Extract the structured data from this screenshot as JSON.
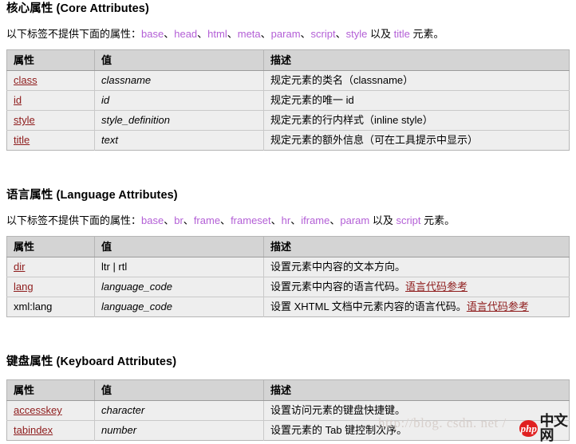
{
  "sections": [
    {
      "heading": "核心属性 (Core Attributes)",
      "intro_prefix": "以下标签不提供下面的属性：",
      "intro_tags": [
        "base",
        "head",
        "html",
        "meta",
        "param",
        "script",
        "style"
      ],
      "intro_mid": " 以及 ",
      "intro_last_tag": "title",
      "intro_suffix": " 元素。",
      "columns": [
        "属性",
        "值",
        "描述"
      ],
      "rows": [
        {
          "attr": "class",
          "attr_is_link": true,
          "value": "classname",
          "value_italic": true,
          "desc": "规定元素的类名（classname）",
          "desc_link": ""
        },
        {
          "attr": "id",
          "attr_is_link": true,
          "value": "id",
          "value_italic": true,
          "desc": "规定元素的唯一 id",
          "desc_link": ""
        },
        {
          "attr": "style",
          "attr_is_link": true,
          "value": "style_definition",
          "value_italic": true,
          "desc": "规定元素的行内样式（inline style）",
          "desc_link": ""
        },
        {
          "attr": "title",
          "attr_is_link": true,
          "value": "text",
          "value_italic": true,
          "desc": "规定元素的额外信息（可在工具提示中显示）",
          "desc_link": ""
        }
      ]
    },
    {
      "heading": "语言属性 (Language Attributes)",
      "intro_prefix": "以下标签不提供下面的属性：",
      "intro_tags": [
        "base",
        "br",
        "frame",
        "frameset",
        "hr",
        "iframe",
        "param"
      ],
      "intro_mid": " 以及 ",
      "intro_last_tag": "script",
      "intro_suffix": " 元素。",
      "columns": [
        "属性",
        "值",
        "描述"
      ],
      "rows": [
        {
          "attr": "dir",
          "attr_is_link": true,
          "value": "ltr | rtl",
          "value_italic": false,
          "desc": "设置元素中内容的文本方向。",
          "desc_link": ""
        },
        {
          "attr": "lang",
          "attr_is_link": true,
          "value": "language_code",
          "value_italic": true,
          "desc": "设置元素中内容的语言代码。",
          "desc_link": "语言代码参考"
        },
        {
          "attr": "xml:lang",
          "attr_is_link": false,
          "value": "language_code",
          "value_italic": true,
          "desc": "设置 XHTML 文档中元素内容的语言代码。",
          "desc_link": "语言代码参考"
        }
      ]
    },
    {
      "heading": "键盘属性 (Keyboard Attributes)",
      "intro_prefix": "",
      "intro_tags": [],
      "intro_mid": "",
      "intro_last_tag": "",
      "intro_suffix": "",
      "columns": [
        "属性",
        "值",
        "描述"
      ],
      "rows": [
        {
          "attr": "accesskey",
          "attr_is_link": true,
          "value": "character",
          "value_italic": true,
          "desc": "设置访问元素的键盘快捷键。",
          "desc_link": ""
        },
        {
          "attr": "tabindex",
          "attr_is_link": true,
          "value": "number",
          "value_italic": true,
          "desc": "设置元素的 Tab 键控制次序。",
          "desc_link": ""
        }
      ]
    }
  ],
  "watermark": {
    "url_text": "http://blog. csdn. net /",
    "logo_badge_text": "php",
    "logo_site_text": "中文网"
  },
  "colors": {
    "tag_purple": "#b35fd6",
    "link_dark_red": "#8e1c1c",
    "table_header_bg": "#d4d4d4",
    "table_row_bg": "#eeeeee",
    "table_border": "#c9c9c9",
    "logo_red": "#e02020"
  }
}
